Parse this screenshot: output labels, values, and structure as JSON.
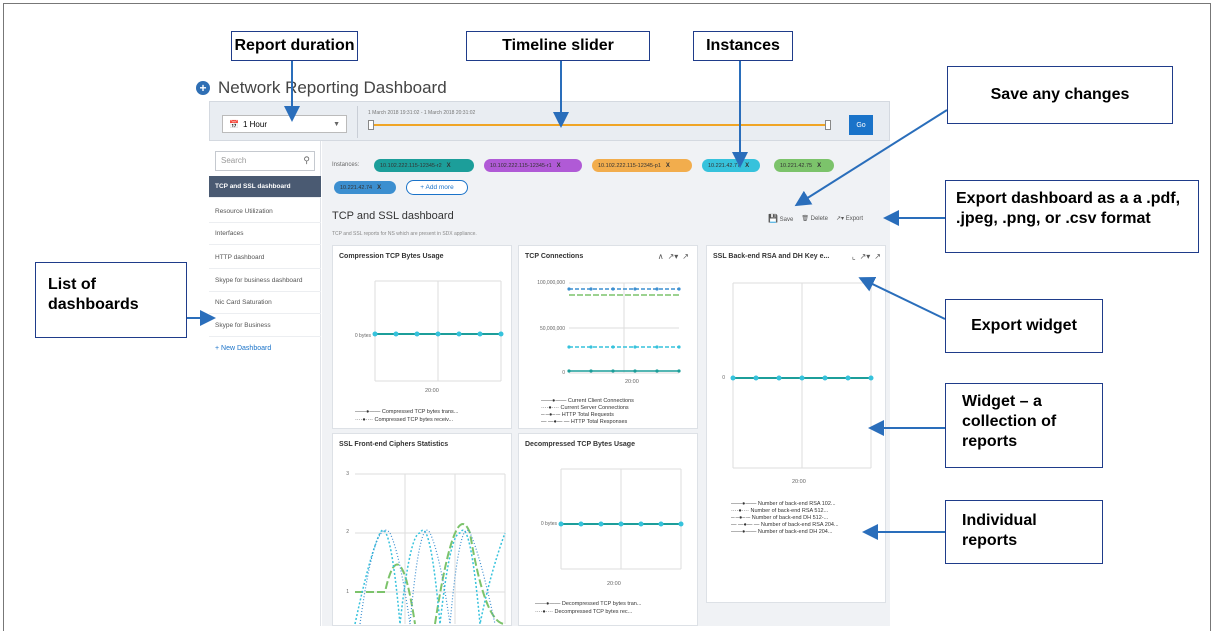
{
  "callouts": {
    "report_duration": "Report duration",
    "timeline_slider": "Timeline slider",
    "instances": "Instances",
    "save_changes": "Save any changes",
    "export_dashboard": "Export dashboard as a a .pdf, .jpeg, .png, or .csv format",
    "list_of_dashboards": "List of dashboards",
    "export_widget": "Export widget",
    "widget": "Widget – a collection of reports",
    "individual_reports": "Individual reports"
  },
  "header": {
    "title": "Network Reporting Dashboard"
  },
  "toolbar": {
    "duration": "1 Hour",
    "range": "1 March 2018 19:31:02 - 1 March 2018 20:31:02",
    "go": "Go"
  },
  "sidebar": {
    "search_placeholder": "Search",
    "items": [
      "TCP and SSL dashboard",
      "Resource Utilization",
      "Interfaces",
      "HTTP dashboard",
      "Skype for business dashboard",
      "Nic Card Saturation",
      "Skype for Business"
    ],
    "new_dashboard": "+ New Dashboard"
  },
  "instances": {
    "label": "Instances:",
    "chips": [
      {
        "label": "10.102.222.115-12345-r2",
        "color": "#1c9e9a"
      },
      {
        "label": "10.102.222.115-12345-r1",
        "color": "#b05ad6"
      },
      {
        "label": "10.102.222.115-12345-p1",
        "color": "#f2ad4d"
      },
      {
        "label": "10.221.42.77",
        "color": "#36c2dc"
      },
      {
        "label": "10.221.42.75",
        "color": "#7cc36b"
      },
      {
        "label": "10.221.42.74",
        "color": "#3c8fd0"
      }
    ],
    "add_more": "+ Add more"
  },
  "dashboard": {
    "title": "TCP and SSL dashboard",
    "subtitle": "TCP and SSL reports for NS which are present in SDX appliance.",
    "save": "Save",
    "delete": "Delete",
    "export": "Export"
  },
  "widgets": {
    "compression": {
      "title": "Compression TCP Bytes Usage",
      "ytick": "0 bytes",
      "xtick": "20:00",
      "legend": [
        "Compressed TCP bytes trans...",
        "Compressed TCP bytes receiv..."
      ]
    },
    "tcp_connections": {
      "title": "TCP Connections",
      "yticks": [
        "100,000,000",
        "50,000,000",
        "0"
      ],
      "xtick": "20:00",
      "legend": [
        "Current Client Connections",
        "Current Server Connections",
        "HTTP Total Requests",
        "HTTP Total Responses"
      ]
    },
    "ssl_backend": {
      "title": "SSL Back-end RSA and DH Key e...",
      "ytick": "0",
      "xtick": "20:00",
      "legend": [
        "Number of back-end RSA 102...",
        "Number of back-end RSA 512...",
        "Number of back-end DH 512-...",
        "Number of back-end RSA 204...",
        "Number of back-end DH 204..."
      ]
    },
    "ssl_frontend": {
      "title": "SSL Front-end Ciphers Statistics",
      "yticks": [
        "3",
        "2",
        "1"
      ]
    },
    "decompressed": {
      "title": "Decompressed TCP Bytes Usage",
      "ytick": "0 bytes",
      "xtick": "20:00",
      "legend": [
        "Decompressed TCP bytes tran...",
        "Decompressed TCP bytes rec..."
      ]
    }
  },
  "colors": {
    "accent": "#1a73c9",
    "callout_border": "#1f3c8a",
    "arrow": "#2a6ebb",
    "series": "#36c2dc",
    "series2": "#1c9e9a",
    "series3": "#7cc36b"
  }
}
